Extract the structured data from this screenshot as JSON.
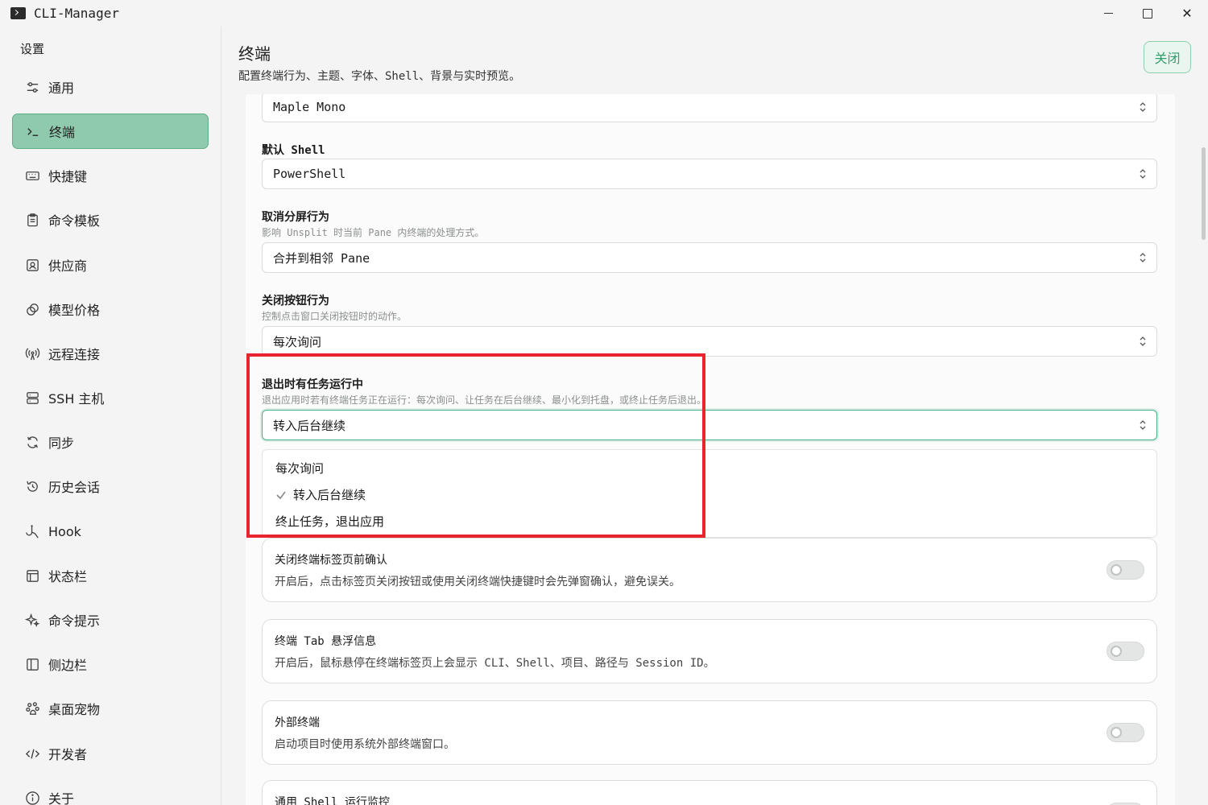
{
  "window": {
    "title": "CLI-Manager",
    "controls": {
      "minimize": "minimize",
      "maximize": "maximize",
      "close": "✕"
    }
  },
  "sidebar": {
    "title": "设置",
    "items": [
      {
        "label": "通用",
        "icon": "sliders-icon"
      },
      {
        "label": "终端",
        "icon": "terminal-icon",
        "active": true
      },
      {
        "label": "快捷键",
        "icon": "keyboard-icon"
      },
      {
        "label": "命令模板",
        "icon": "clipboard-icon"
      },
      {
        "label": "供应商",
        "icon": "provider-icon"
      },
      {
        "label": "模型价格",
        "icon": "coins-icon"
      },
      {
        "label": "远程连接",
        "icon": "radio-icon"
      },
      {
        "label": "SSH 主机",
        "icon": "server-icon"
      },
      {
        "label": "同步",
        "icon": "sync-icon"
      },
      {
        "label": "历史会话",
        "icon": "history-icon"
      },
      {
        "label": "Hook",
        "icon": "hook-icon"
      },
      {
        "label": "状态栏",
        "icon": "layout-icon"
      },
      {
        "label": "命令提示",
        "icon": "sparkles-icon"
      },
      {
        "label": "侧边栏",
        "icon": "sidebar-icon"
      },
      {
        "label": "桌面宠物",
        "icon": "pet-icon"
      },
      {
        "label": "开发者",
        "icon": "code-icon"
      },
      {
        "label": "关于",
        "icon": "info-icon"
      }
    ]
  },
  "header": {
    "title": "终端",
    "subtitle": "配置终端行为、主题、字体、Shell、背景与实时预览。",
    "close_label": "关闭"
  },
  "settings": {
    "font_select": {
      "value": "Maple Mono"
    },
    "default_shell": {
      "label": "默认 Shell",
      "value": "PowerShell"
    },
    "unsplit": {
      "label": "取消分屏行为",
      "hint": "影响 Unsplit 时当前 Pane 内终端的处理方式。",
      "value": "合并到相邻 Pane"
    },
    "close_button": {
      "label": "关闭按钮行为",
      "hint": "控制点击窗口关闭按钮时的动作。",
      "value": "每次询问"
    },
    "exit_running": {
      "label": "退出时有任务运行中",
      "hint": "退出应用时若有终端任务正在运行：每次询问、让任务在后台继续、最小化到托盘，或终止任务后退出。",
      "value": "转入后台继续",
      "options": [
        "每次询问",
        "转入后台继续",
        "终止任务，退出应用"
      ],
      "selected_index": 1
    },
    "toggles": [
      {
        "title": "关闭终端标签页前确认",
        "desc": "开启后，点击标签页关闭按钮或使用关闭终端快捷键时会先弹窗确认，避免误关。",
        "on": false
      },
      {
        "title": "终端 Tab 悬浮信息",
        "desc": "开启后，鼠标悬停在终端标签页上会显示 CLI、Shell、项目、路径与 Session ID。",
        "on": false
      },
      {
        "title": "外部终端",
        "desc": "启动项目时使用系统外部终端窗口。",
        "on": false
      },
      {
        "title": "通用 Shell 运行监控",
        "desc": "",
        "on": false
      }
    ]
  },
  "colors": {
    "accent": "#44b083",
    "active_nav": "#8fcaae",
    "highlight": "#e8242e"
  }
}
